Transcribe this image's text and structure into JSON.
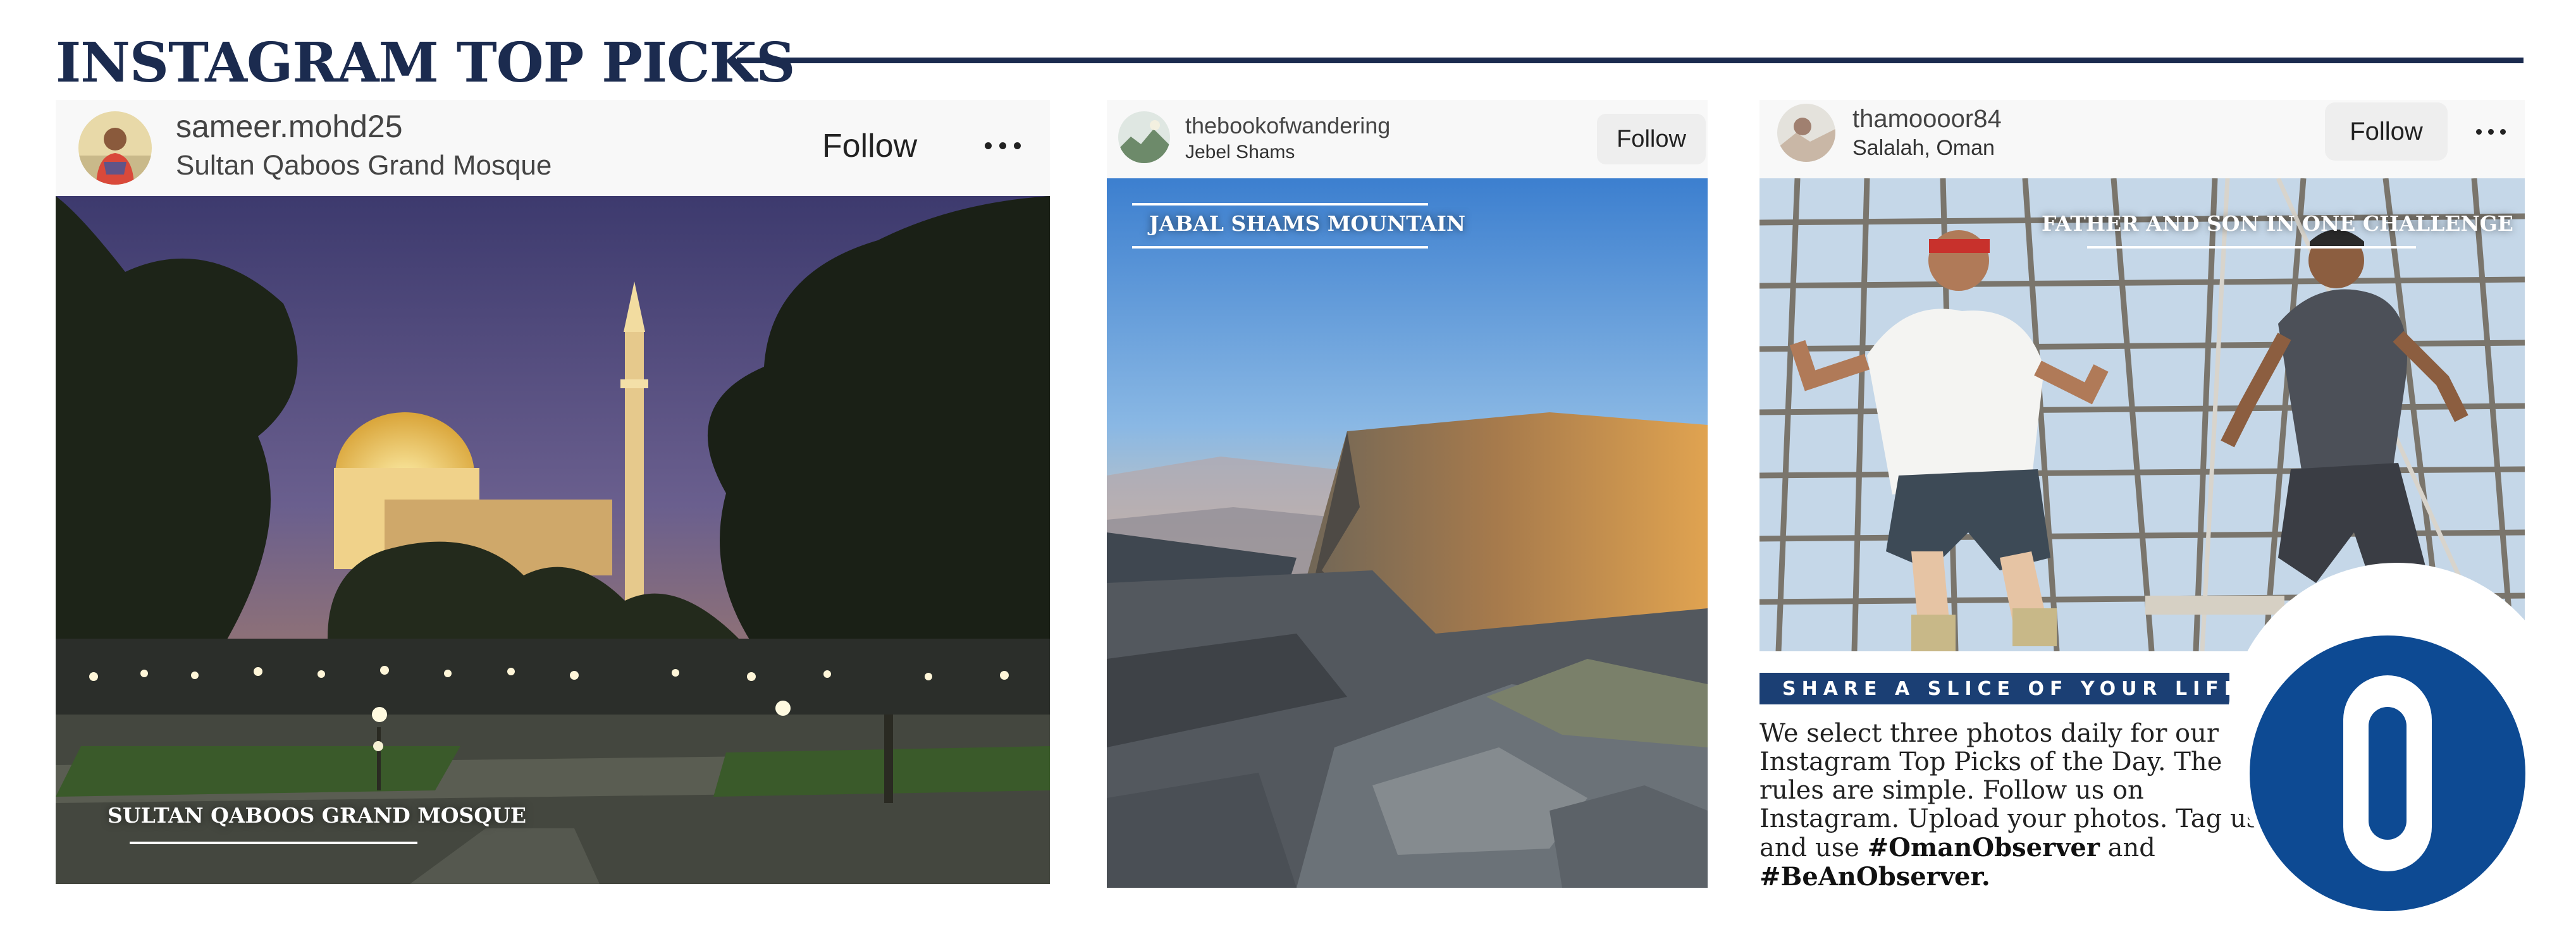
{
  "heading": "INSTAGRAM TOP PICKS",
  "posts": [
    {
      "username": "sameer.mohd25",
      "location": "Sultan Qaboos Grand Mosque",
      "follow_label": "Follow",
      "caption": "SULTAN QABOOS GRAND MOSQUE"
    },
    {
      "username": "thebookofwandering",
      "location": "Jebel Shams",
      "follow_label": "Follow",
      "caption": "JABAL SHAMS  MOUNTAIN"
    },
    {
      "username": "thamoooor84",
      "location": "Salalah, Oman",
      "follow_label": "Follow",
      "caption": "FATHER AND SON IN ONE CHALLENGE"
    }
  ],
  "sidebar": {
    "banner": "SHARE A SLICE OF YOUR LIFE",
    "text_1": "We select three photos daily for our Instagram Top Picks of the Day. The rules are simple. Follow us on Instagram. Upload your photos. Tag us and use",
    "hashtag_1": "#OmanObserver",
    "text_2": "and",
    "hashtag_2": "#BeAnObserver."
  },
  "colors": {
    "navy": "#1b2b4f",
    "banner": "#1b3f74",
    "logo_blue": "#0d4a93"
  },
  "icons": {
    "more": "more-options-icon"
  }
}
